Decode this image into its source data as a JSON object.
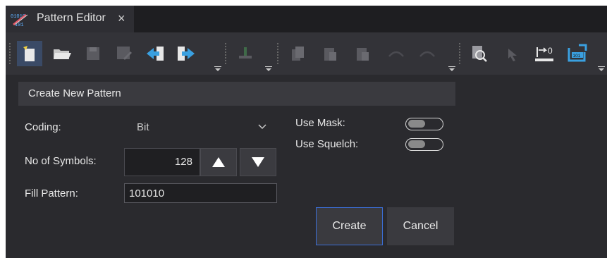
{
  "tab": {
    "title": "Pattern Editor",
    "close_glyph": "×",
    "icon": "pattern-editor-icon",
    "icon_text_top": "01010",
    "icon_text_bottom": "101"
  },
  "toolbar": {
    "groups": [
      {
        "name": "file",
        "buttons": [
          "new-pattern-icon",
          "open-folder-icon",
          "save-icon",
          "save-as-icon",
          "import-icon",
          "export-icon"
        ]
      },
      {
        "name": "edit",
        "buttons": [
          "insert-icon"
        ]
      },
      {
        "name": "clipboard",
        "buttons": [
          "copy-icon",
          "paste-icon",
          "paste-special-icon",
          "undo-icon",
          "redo-icon"
        ]
      },
      {
        "name": "view",
        "buttons": [
          "zoom-fit-icon",
          "select-icon",
          "go-to-start-icon",
          "symbol-view-icon"
        ]
      }
    ],
    "go_to_start_label": "0",
    "symbol_view_label": "101"
  },
  "form": {
    "header": "Create New Pattern",
    "coding_label": "Coding:",
    "coding_value": "Bit",
    "symbols_label": "No of Symbols:",
    "symbols_value": "128",
    "fill_label": "Fill Pattern:",
    "fill_value": "101010",
    "mask_label": "Use Mask:",
    "squelch_label": "Use Squelch:",
    "use_mask": false,
    "use_squelch": false
  },
  "buttons": {
    "create": "Create",
    "cancel": "Cancel"
  },
  "colors": {
    "accent": "#3b6fd8",
    "toolbar_active": "#3a4a66",
    "arrow_blue": "#3aa0e0"
  }
}
